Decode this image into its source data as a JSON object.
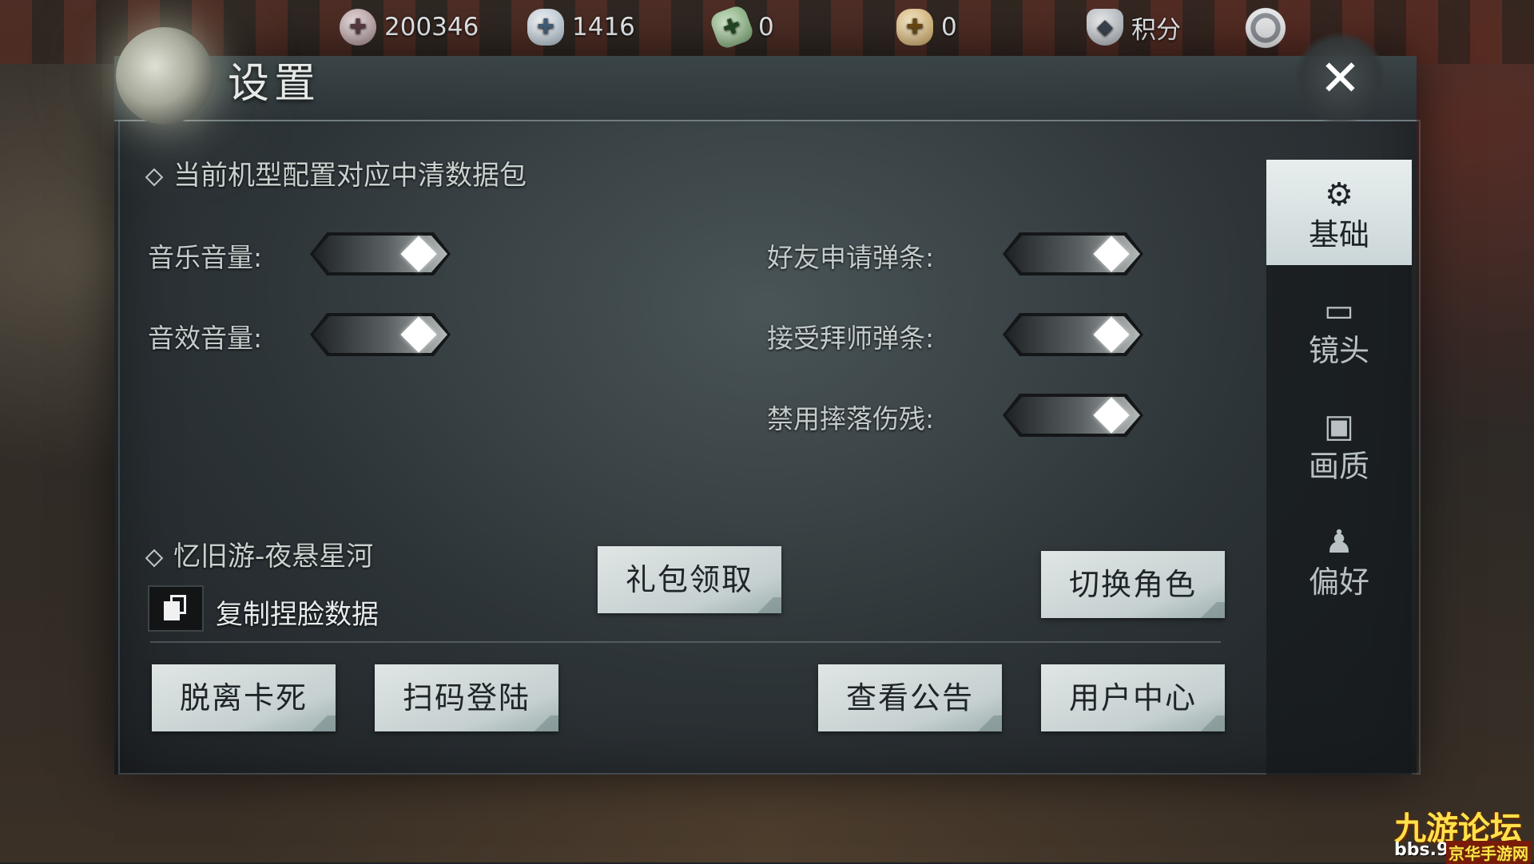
{
  "currencies": [
    {
      "icon": "coin-icon",
      "value": "200346"
    },
    {
      "icon": "silver-ingot-icon",
      "value": "1416"
    },
    {
      "icon": "jade-icon",
      "value": "0"
    },
    {
      "icon": "gold-ingot-icon",
      "value": "0"
    },
    {
      "icon": "shield-icon",
      "value": "积分"
    }
  ],
  "panel": {
    "title": "设置",
    "close_symbol": "✕"
  },
  "tabs": [
    {
      "label": "基础",
      "icon": "gear-icon",
      "active": true
    },
    {
      "label": "镜头",
      "icon": "camera-frame-icon",
      "active": false
    },
    {
      "label": "画质",
      "icon": "monitor-icon",
      "active": false
    },
    {
      "label": "偏好",
      "icon": "user-gear-icon",
      "active": false
    }
  ],
  "section1": {
    "heading": "当前机型配置对应中清数据包",
    "settings_left": [
      {
        "label": "音乐音量:",
        "value": 1.0
      },
      {
        "label": "音效音量:",
        "value": 1.0
      }
    ],
    "settings_right": [
      {
        "label": "好友申请弹条:",
        "on": true
      },
      {
        "label": "接受拜师弹条:",
        "on": true
      },
      {
        "label": "禁用摔落伤残:",
        "on": true
      }
    ]
  },
  "section2": {
    "heading": "忆旧游-夜悬星河",
    "copy_label": "复制捏脸数据",
    "gift_button": "礼包领取",
    "switch_role_button": "切换角色"
  },
  "bottom_buttons": {
    "unstuck": "脱离卡死",
    "scan_login": "扫码登陆",
    "announcement": "查看公告",
    "user_center": "用户中心"
  },
  "watermark": {
    "main": "九游论坛",
    "sub": "bbs.9",
    "sub2": "京华手游网"
  }
}
